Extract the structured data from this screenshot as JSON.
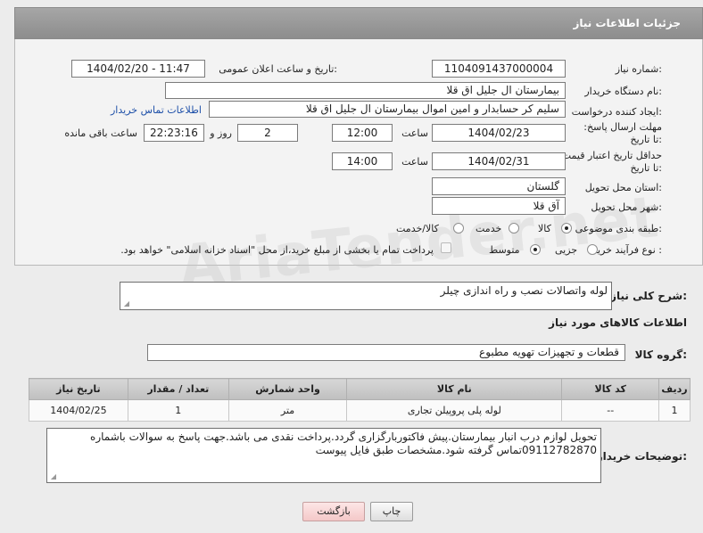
{
  "header": {
    "title": "جزئیات اطلاعات نیاز"
  },
  "form": {
    "need_number_label": "شماره نیاز:",
    "need_number": "1104091437000004",
    "announce_label": "تاریخ و ساعت اعلان عمومی:",
    "announce_value": "1404/02/20 - 11:47",
    "buyer_org_label": "نام دستگاه خریدار:",
    "buyer_org": "بیمارستان ال جلیل اق قلا",
    "creator_label": "ایجاد کننده درخواست:",
    "creator": "سلیم کر حسابدار و امین اموال بیمارستان ال جلیل اق قلا",
    "contact_link": "اطلاعات تماس خریدار",
    "deadline_label": "مهلت ارسال پاسخ: تا تاریخ:",
    "deadline_date": "1404/02/23",
    "time_label": "ساعت",
    "deadline_time": "12:00",
    "days_value": "2",
    "days_label": "روز و",
    "remaining_time": "22:23:16",
    "remaining_label": "ساعت باقی مانده",
    "price_deadline_label": "حداقل تاریخ اعتبار قیمت: تا تاریخ:",
    "price_date": "1404/02/31",
    "price_time": "14:00",
    "province_label": "استان محل تحویل:",
    "province": "گلستان",
    "city_label": "شهر محل تحویل:",
    "city": "آق قلا",
    "category_label": "طبقه بندی موضوعی:",
    "category_options": [
      "کالا",
      "خدمت",
      "کالا/خدمت"
    ],
    "process_label": "نوع فرآیند خرید :",
    "process_options": [
      "جزیی",
      "متوسط"
    ],
    "payment_note": "پرداخت تمام یا بخشی از مبلغ خرید،از محل \"اسناد خزانه اسلامی\" خواهد بود."
  },
  "description": {
    "label": "شرح کلی نیاز:",
    "text": "لوله واتصالات نصب و راه اندازی چیلر"
  },
  "goods_section": {
    "title": "اطلاعات کالاهای مورد نیاز",
    "group_label": "گروه کالا:",
    "group_value": "قطعات و تجهیزات تهویه مطبوع"
  },
  "table": {
    "headers": [
      "ردیف",
      "کد کالا",
      "نام کالا",
      "واحد شمارش",
      "تعداد / مقدار",
      "تاریخ نیاز"
    ],
    "rows": [
      [
        "1",
        "--",
        "لوله پلی پروپیلن تجاری",
        "متر",
        "1",
        "1404/02/25"
      ]
    ]
  },
  "buyer_notes": {
    "label": "توضیحات خریدار:",
    "text": "تحویل لوازم درب انبار بیمارستان.پیش فاکتوربارگزاری گردد.پرداخت نقدی می باشد.جهت پاسخ به سوالات باشماره 09112782870تماس گرفته شود.مشخصات طبق فایل پیوست"
  },
  "buttons": {
    "print": "چاپ",
    "back": "بازگشت"
  },
  "watermark": "AriaTender.net",
  "colors": {
    "link": "#1d4fa8",
    "header": "#9a9a9a"
  }
}
